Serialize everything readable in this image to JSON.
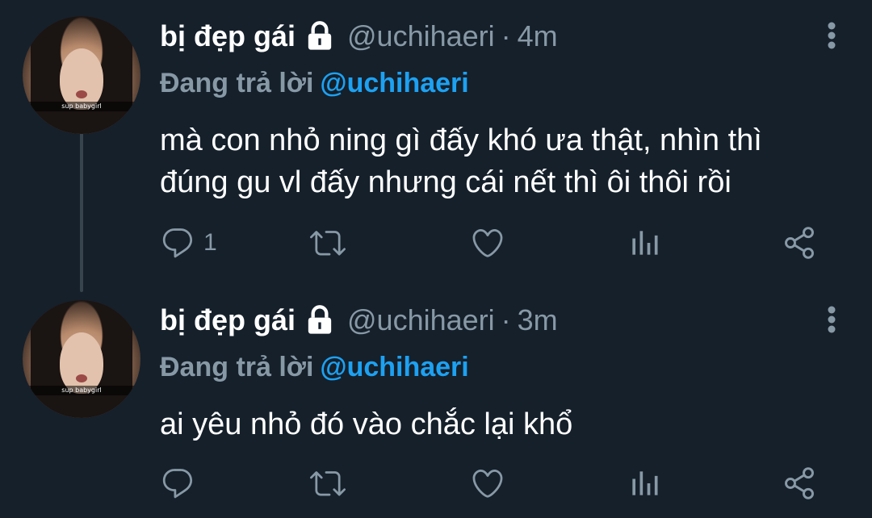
{
  "tweets": [
    {
      "avatar_caption": "sup babygirl",
      "display_name": "bị đẹp gái",
      "handle": "@uchihaeri",
      "separator": "·",
      "time": "4m",
      "reply_prefix": "Đang trả lời",
      "reply_mention": "@uchihaeri",
      "text_line1": "mà con nhỏ ning gì đấy khó ưa thật, nhìn thì",
      "text_line2": "đúng gu vl đấy nhưng cái nết thì ôi thôi rồi",
      "reply_count": "1"
    },
    {
      "avatar_caption": "sup babygirl",
      "display_name": "bị đẹp gái",
      "handle": "@uchihaeri",
      "separator": "·",
      "time": "3m",
      "reply_prefix": "Đang trả lời",
      "reply_mention": "@uchihaeri",
      "text_line1": "ai yêu nhỏ đó vào chắc lại khổ",
      "reply_count": ""
    }
  ],
  "icons": {
    "lock": "lock-icon",
    "more": "more-vertical-icon",
    "reply": "reply-icon",
    "retweet": "retweet-icon",
    "like": "heart-icon",
    "analytics": "analytics-icon",
    "share": "share-icon"
  },
  "colors": {
    "background": "#15202b",
    "text": "#ffffff",
    "muted": "#8899a6",
    "mention": "#1da1f2",
    "thread_line": "#38444d"
  }
}
